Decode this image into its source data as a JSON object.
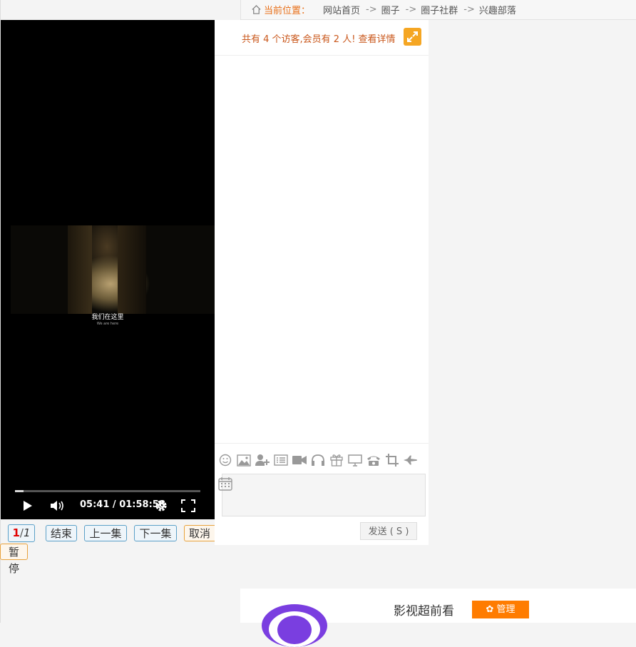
{
  "breadcrumb": {
    "current_label": "当前位置：",
    "items": [
      "网站首页",
      "圈子",
      "圈子社群",
      "兴趣部落"
    ],
    "separator": "->"
  },
  "video": {
    "subtitle": "我们在这里",
    "subtitle_small": "We are here",
    "time_current": "05:41",
    "time_total": "01:58:58",
    "time_sep": " / ",
    "progress": 0.048
  },
  "controls": {
    "page_current": "1",
    "page_sep": "/",
    "page_total": "1",
    "end_label": "结束",
    "prev_label": "上一集",
    "next_label": "下一集",
    "cancel_label": "取消",
    "pause_label": "暂停"
  },
  "chat": {
    "visitor_text": "共有 4 个访客,会员有 2 人! 查看详情",
    "toolbar_icons": [
      "smile-icon",
      "image-icon",
      "add-user-icon",
      "list-icon",
      "video-icon",
      "headphones-icon",
      "gift-icon",
      "monitor-icon",
      "phone-icon",
      "crop-icon",
      "plane-icon"
    ],
    "send_label": "发送 ( S )"
  },
  "card": {
    "name": "影视超前看",
    "manage_label": "管理"
  },
  "colors": {
    "accent_orange": "#e8701a",
    "manage_orange": "#ff7c00",
    "logo_purple": "#7a3ee0"
  }
}
